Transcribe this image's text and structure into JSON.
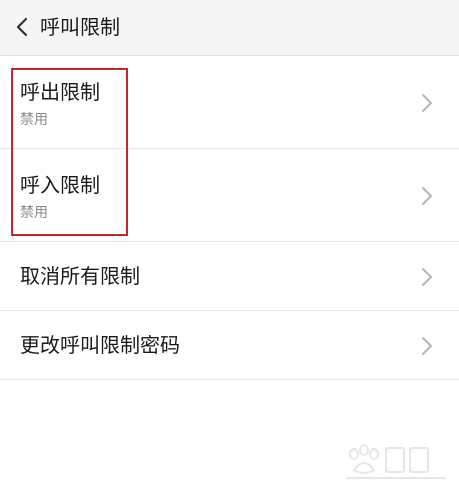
{
  "header": {
    "title": "呼叫限制",
    "back_icon": "chevron-left-icon"
  },
  "list": {
    "items": [
      {
        "title": "呼出限制",
        "subtitle": "禁用"
      },
      {
        "title": "呼入限制",
        "subtitle": "禁用"
      },
      {
        "title": "取消所有限制"
      },
      {
        "title": "更改呼叫限制密码"
      }
    ],
    "chevron_icon": "chevron-right-icon"
  },
  "colors": {
    "header_bg": "#f5f5f5",
    "highlight": "#c3282f",
    "subtitle": "#8a8a8a",
    "chevron": "#b5b5b5"
  }
}
